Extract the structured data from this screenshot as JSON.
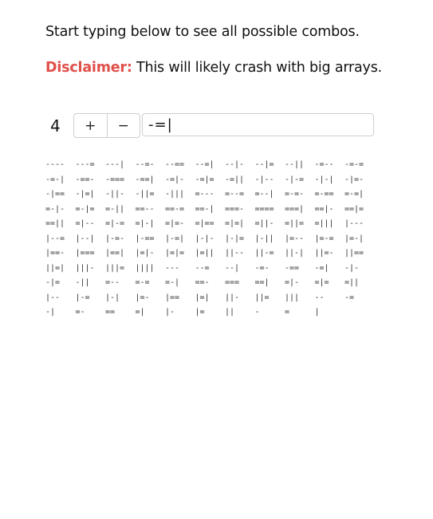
{
  "intro": {
    "text": "Start typing below to see all possible combos."
  },
  "disclaimer": {
    "label": "Disclaimer:",
    "text": " This will likely crash with big arrays."
  },
  "controls": {
    "length": "4",
    "plus_label": "+",
    "minus_label": "−",
    "chars_value": "-=|"
  },
  "combos": [
    "----",
    "---=",
    "---|",
    "--=-",
    "--==",
    "--=|",
    "--|-",
    "--|=",
    "--||",
    "-=--",
    "-=-=",
    "-=-|",
    "-==-",
    "-===",
    "-==|",
    "-=|-",
    "-=|=",
    "-=||",
    "-|--",
    "-|-=",
    "-|-|",
    "-|=-",
    "-|==",
    "-|=|",
    "-||-",
    "-||=",
    "-|||",
    "=---",
    "=--=",
    "=--|",
    "=-=-",
    "=-==",
    "=-=|",
    "=-|-",
    "=-|=",
    "=-||",
    "==--",
    "==-=",
    "==-|",
    "===-",
    "====",
    "===|",
    "==|-",
    "==|=",
    "==||",
    "=|--",
    "=|-=",
    "=|-|",
    "=|=-",
    "=|==",
    "=|=|",
    "=||-",
    "=||=",
    "=|||",
    "|---",
    "|--=",
    "|--|",
    "|-=-",
    "|-==",
    "|-=|",
    "|-|-",
    "|-|=",
    "|-||",
    "|=--",
    "|=-=",
    "|=-|",
    "|==-",
    "|===",
    "|==|",
    "|=|-",
    "|=|=",
    "|=||",
    "||--",
    "||-=",
    "||-|",
    "||=-",
    "||==",
    "||=|",
    "|||-",
    "|||=",
    "||||",
    "---",
    "--=",
    "--|",
    "-=-",
    "-==",
    "-=|",
    "-|-",
    "-|=",
    "-||",
    "=--",
    "=-=",
    "=-|",
    "==-",
    "===",
    "==|",
    "=|-",
    "=|=",
    "=||",
    "|--",
    "|-=",
    "|-|",
    "|=-",
    "|==",
    "|=|",
    "||-",
    "||=",
    "|||",
    "--",
    "-=",
    "-|",
    "=-",
    "==",
    "=|",
    "|-",
    "|=",
    "||",
    "-",
    "=",
    "|"
  ]
}
